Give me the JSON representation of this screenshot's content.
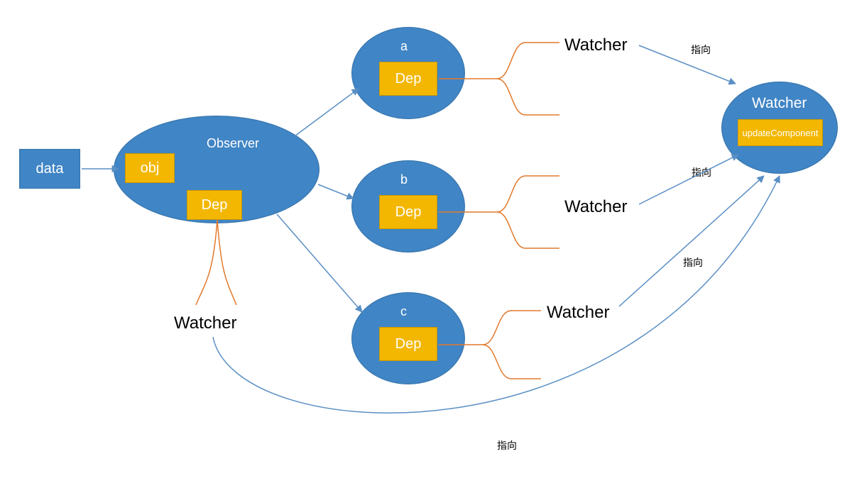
{
  "colors": {
    "blue": "#4085c5",
    "blueBorder": "#3572a9",
    "yellow": "#f3b701",
    "yellowBorder": "#c79600",
    "arrowBlue": "#5a8fc4",
    "bracketOrange": "#e2792b"
  },
  "nodes": {
    "data": "data",
    "observer": {
      "title": "Observer",
      "obj": "obj",
      "dep": "Dep"
    },
    "a": {
      "title": "a",
      "dep": "Dep"
    },
    "b": {
      "title": "b",
      "dep": "Dep"
    },
    "c": {
      "title": "c",
      "dep": "Dep"
    },
    "watcherNode": {
      "title": "Watcher",
      "content": "updateComponent"
    }
  },
  "labels": {
    "watcher": "Watcher",
    "point": "指向"
  }
}
